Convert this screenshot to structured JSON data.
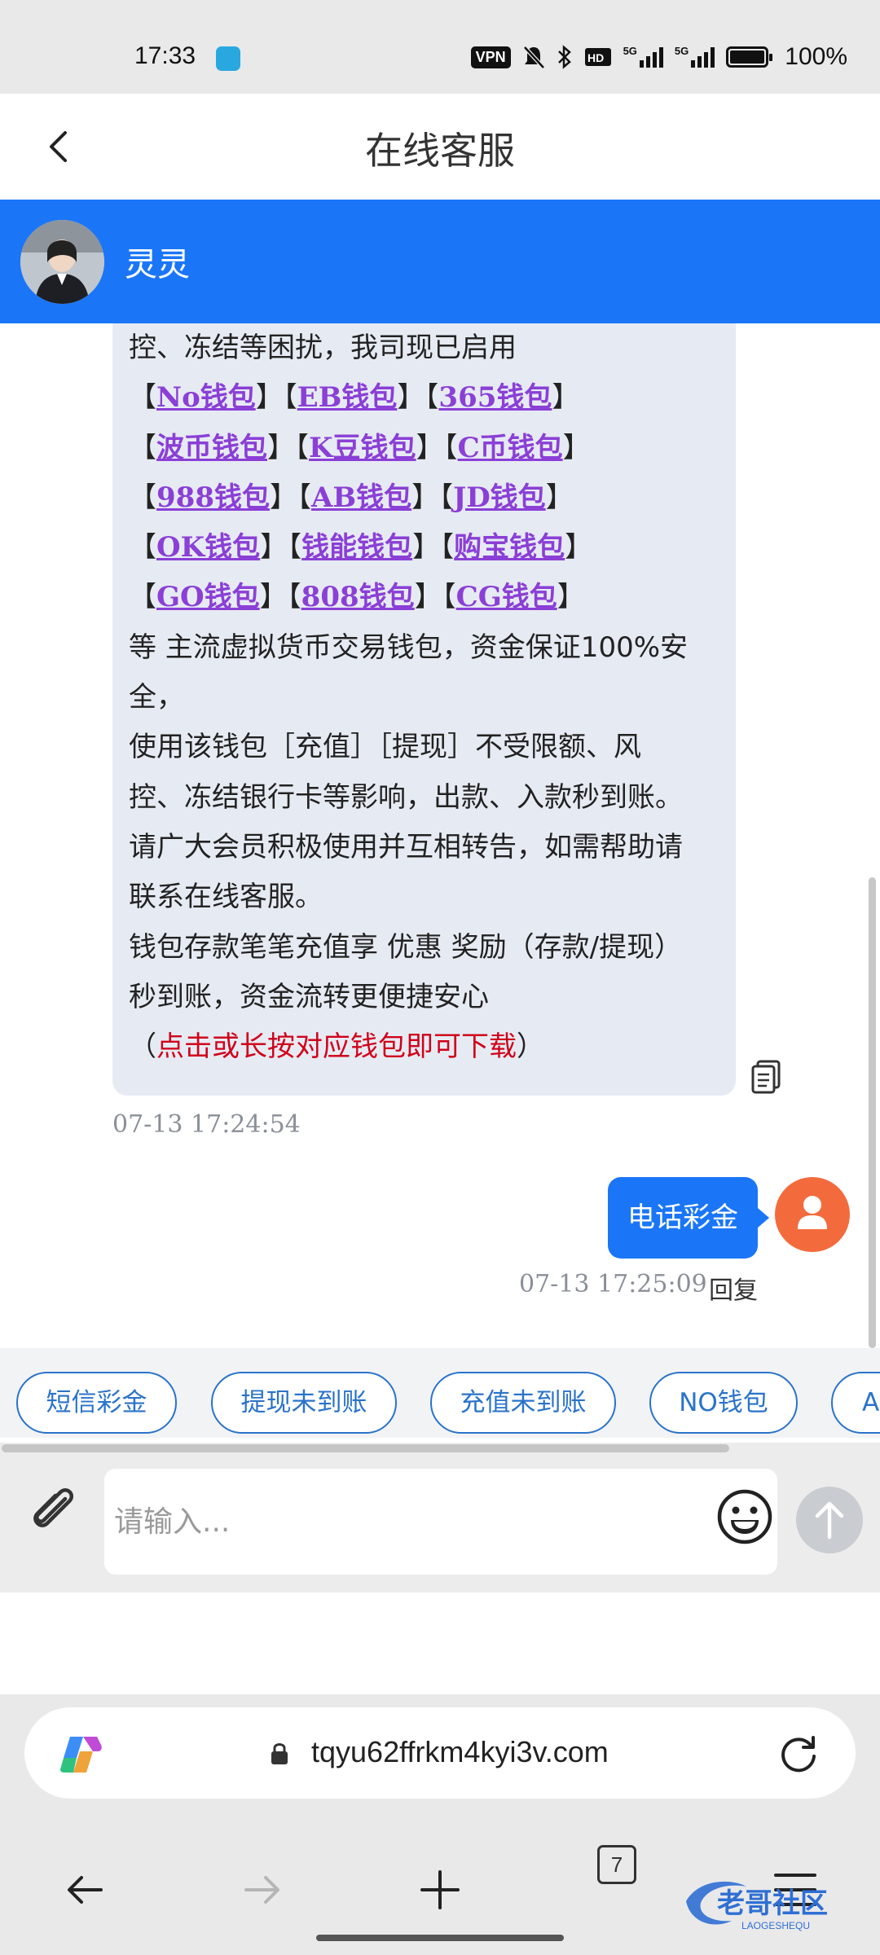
{
  "status_bar": {
    "time": "17:33",
    "vpn": "VPN",
    "network_1": "5G",
    "network_2": "5G",
    "battery_level": 1.0,
    "battery_text": "100%"
  },
  "header": {
    "title": "在线客服"
  },
  "agent": {
    "name": "灵灵"
  },
  "message": {
    "lines": [
      [
        {
          "t": "控、冻结等困扰，我司现已启用"
        }
      ],
      [
        {
          "t": "【"
        },
        {
          "t": "No钱包",
          "link": true
        },
        {
          "t": "】【"
        },
        {
          "t": "EB钱包",
          "link": true
        },
        {
          "t": "】【"
        },
        {
          "t": "365钱包",
          "link": true
        },
        {
          "t": "】"
        }
      ],
      [
        {
          "t": "【"
        },
        {
          "t": "波币钱包",
          "link": true
        },
        {
          "t": "】【"
        },
        {
          "t": "K豆钱包",
          "link": true
        },
        {
          "t": "】【"
        },
        {
          "t": "C币钱包",
          "link": true
        },
        {
          "t": "】"
        }
      ],
      [
        {
          "t": "【"
        },
        {
          "t": "988钱包",
          "link": true
        },
        {
          "t": "】【"
        },
        {
          "t": "AB钱包",
          "link": true
        },
        {
          "t": "】【"
        },
        {
          "t": "JD钱包",
          "link": true
        },
        {
          "t": "】"
        }
      ],
      [
        {
          "t": "【"
        },
        {
          "t": "OK钱包",
          "link": true
        },
        {
          "t": "】【"
        },
        {
          "t": "钱能钱包",
          "link": true
        },
        {
          "t": "】【"
        },
        {
          "t": "购宝钱包",
          "link": true
        },
        {
          "t": "】"
        }
      ],
      [
        {
          "t": "【"
        },
        {
          "t": "GO钱包",
          "link": true
        },
        {
          "t": "】【"
        },
        {
          "t": "808钱包",
          "link": true
        },
        {
          "t": "】【"
        },
        {
          "t": "CG钱包",
          "link": true
        },
        {
          "t": "】"
        }
      ],
      [
        {
          "t": "等 主流虚拟货币交易钱包，资金保证100%安"
        }
      ],
      [
        {
          "t": "全，"
        }
      ],
      [
        {
          "t": "使用该钱包［充值］［提现］不受限额、风"
        }
      ],
      [
        {
          "t": "控、冻结银行卡等影响，出款、入款秒到账。"
        }
      ],
      [
        {
          "t": "请广大会员积极使用并互相转告，如需帮助请"
        }
      ],
      [
        {
          "t": "联系在线客服。"
        }
      ],
      [
        {
          "t": "钱包存款笔笔充值享 优惠 奖励（存款/提现）"
        }
      ],
      [
        {
          "t": "秒到账，资金流转更便捷安心"
        }
      ],
      [
        {
          "t": "（"
        },
        {
          "t": "点击或长按对应钱包即可下载",
          "red": true
        },
        {
          "t": "）"
        }
      ]
    ],
    "timestamp": "07-13 17:24:54"
  },
  "user_message": {
    "text": "电话彩金",
    "timestamp": "07-13 17:25:09",
    "reply_label": "回复"
  },
  "quick_replies": [
    "短信彩金",
    "提现未到账",
    "充值未到账",
    "NO钱包",
    "A"
  ],
  "composer": {
    "placeholder": "请输入..."
  },
  "browser": {
    "url": "tqyu62ffrkm4kyi3v.com",
    "tab_count": "7"
  },
  "watermark": {
    "text": "老哥社区",
    "subtext": "LAOGESHEQU"
  },
  "colors": {
    "accent_blue": "#1a76f7",
    "link_purple": "#8b3fd6",
    "warning_red": "#d0021b",
    "bubble_bg": "#e6ebf3",
    "user_avatar": "#f36b3c"
  },
  "icons": {
    "back": "chevron-left-icon",
    "copy": "copy-icon",
    "attach": "paperclip-icon",
    "emoji": "smiley-icon",
    "send": "arrow-up-icon",
    "reload": "reload-icon"
  }
}
